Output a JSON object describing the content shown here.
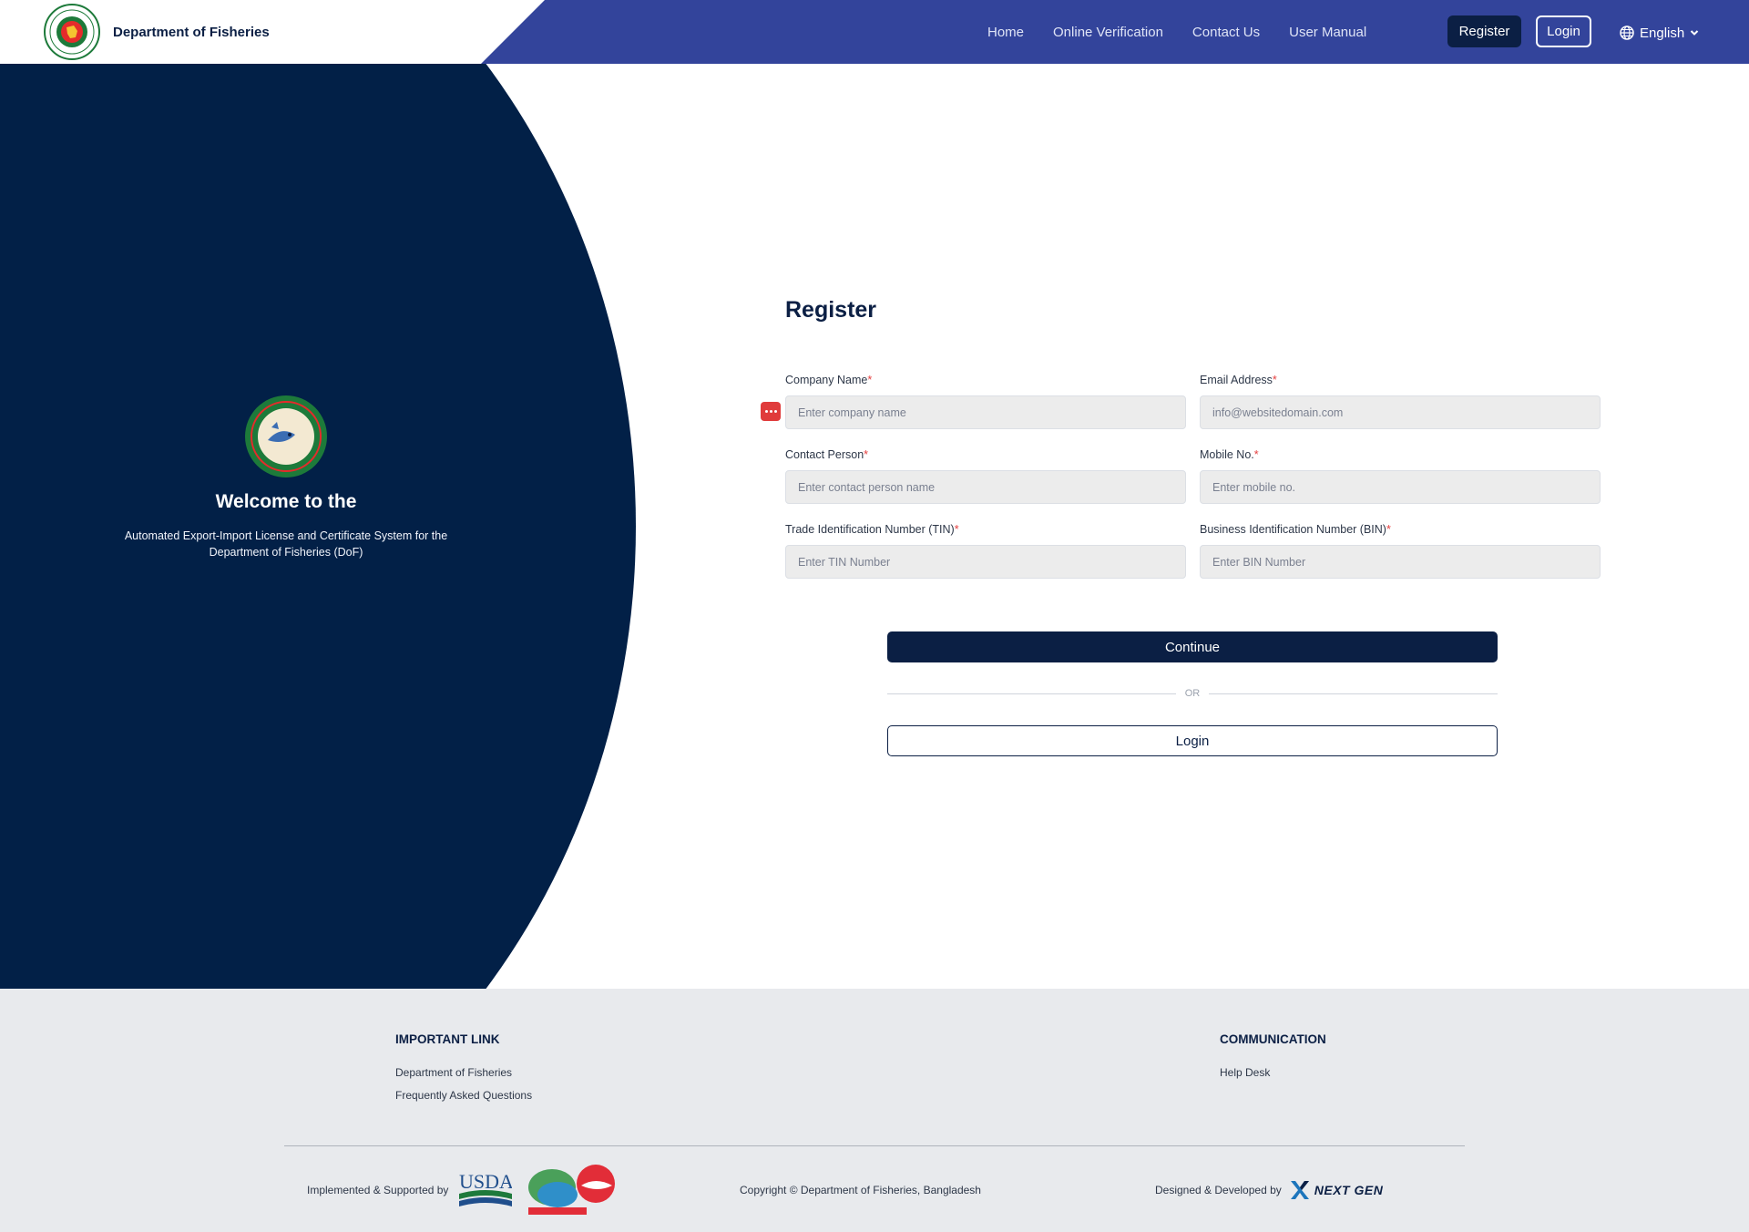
{
  "header": {
    "brand_title": "Department of Fisheries",
    "nav": [
      {
        "label": "Home"
      },
      {
        "label": "Online Verification"
      },
      {
        "label": "Contact Us"
      },
      {
        "label": "User Manual"
      }
    ],
    "register_label": "Register",
    "login_label": "Login",
    "language": "English"
  },
  "hero": {
    "title": "Welcome to the",
    "subtitle": "Automated Export-Import License and Certificate System for the Department of Fisheries (DoF)"
  },
  "form": {
    "title": "Register",
    "company": {
      "label": "Company Name",
      "required": "*",
      "placeholder": "Enter company name"
    },
    "email": {
      "label": "Email Address",
      "required": "*",
      "placeholder": "info@websitedomain.com"
    },
    "contact": {
      "label": "Contact Person",
      "required": "*",
      "placeholder": "Enter contact person name"
    },
    "mobile": {
      "label": "Mobile No.",
      "required": "*",
      "placeholder": "Enter mobile no."
    },
    "tin": {
      "label": "Trade Identification Number (TIN)",
      "required": "*",
      "placeholder": "Enter TIN Number"
    },
    "bin": {
      "label": "Business Identification Number (BIN)",
      "required": "*",
      "placeholder": "Enter BIN Number"
    },
    "continue_label": "Continue",
    "or_label": "OR",
    "login_label": "Login"
  },
  "footer": {
    "important_heading": "IMPORTANT LINK",
    "important_links": [
      {
        "label": "Department of Fisheries"
      },
      {
        "label": "Frequently Asked Questions"
      }
    ],
    "communication_heading": "COMMUNICATION",
    "communication_links": [
      {
        "label": "Help Desk"
      }
    ],
    "implemented_text": "Implemented & Supported by",
    "copyright": "Copyright © Department of Fisheries, Bangladesh",
    "designed_text": "Designed & Developed by",
    "developer_name": "NEXT GEN",
    "usda_logo_text": "USDA"
  },
  "colors": {
    "navy": "#022047",
    "header_blue": "#33449b",
    "required_red": "#e53e3e",
    "footer_bg": "#e8eaed"
  }
}
